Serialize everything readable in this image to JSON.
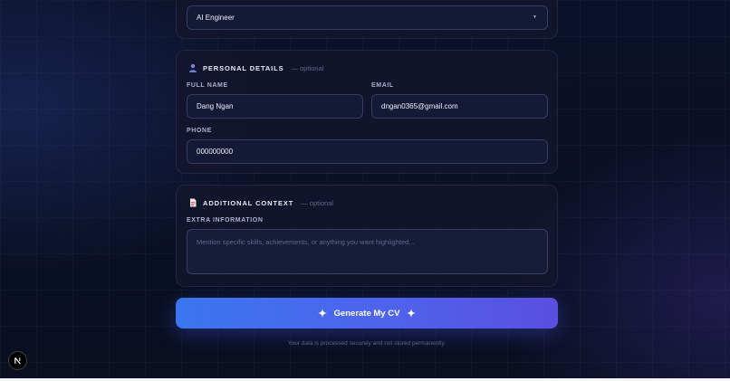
{
  "role_select": {
    "value": "AI Engineer"
  },
  "personal": {
    "title": "PERSONAL DETAILS",
    "optional": "— optional",
    "full_name_label": "FULL NAME",
    "full_name_value": "Dang Ngan",
    "email_label": "EMAIL",
    "email_value": "dngan0365@gmail.com",
    "phone_label": "PHONE",
    "phone_value": "000000000"
  },
  "context": {
    "title": "ADDITIONAL CONTEXT",
    "optional": "— optional",
    "extra_label": "EXTRA INFORMATION",
    "extra_placeholder": "Mention specific skills, achievements, or anything you want highlighted..."
  },
  "generate_label": "Generate My CV",
  "footnote": "Your data is processed securely and not stored permanently.",
  "badge_letter": "N",
  "colors": {
    "accent_start": "#3a76f0",
    "accent_end": "#5a4fe0",
    "background": "#0a0f22"
  }
}
